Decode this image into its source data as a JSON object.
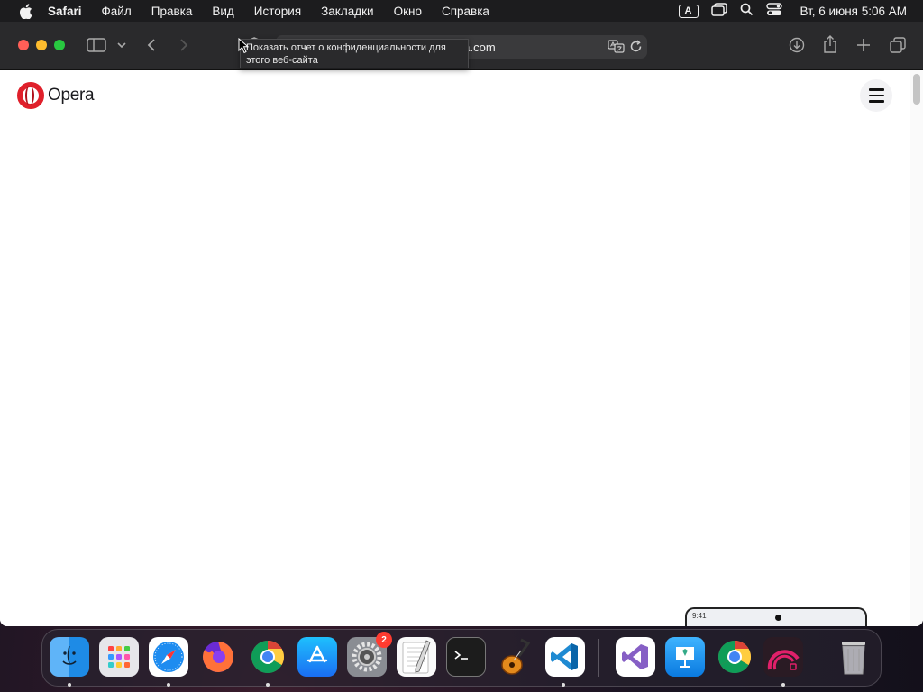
{
  "menubar": {
    "app_name": "Safari",
    "items": [
      "Файл",
      "Правка",
      "Вид",
      "История",
      "Закладки",
      "Окно",
      "Справка"
    ],
    "input_source": "A",
    "datetime": "Вт, 6 июня  5:06 AM"
  },
  "browser": {
    "url": "opera.com",
    "tooltip": "Показать отчет о конфиденциальности для этого веб-сайта"
  },
  "page": {
    "brand": "Opera",
    "phone_time": "9:41"
  },
  "dock": {
    "apps": [
      {
        "name": "Finder",
        "running": true
      },
      {
        "name": "Launchpad",
        "running": false
      },
      {
        "name": "Safari",
        "running": true
      },
      {
        "name": "Firefox",
        "running": false
      },
      {
        "name": "Google Chrome",
        "running": true
      },
      {
        "name": "App Store",
        "running": false
      },
      {
        "name": "System Settings",
        "running": false,
        "badge": "2"
      },
      {
        "name": "TextEdit",
        "running": false
      },
      {
        "name": "Terminal",
        "running": false
      },
      {
        "name": "GarageBand",
        "running": false
      },
      {
        "name": "Visual Studio Code",
        "running": true
      },
      {
        "name": "Visual Studio",
        "running": false
      },
      {
        "name": "Keynote",
        "running": false
      },
      {
        "name": "Google Chrome",
        "running": false
      },
      {
        "name": "Speedometer",
        "running": true
      },
      {
        "name": "Trash",
        "running": false
      }
    ]
  },
  "colors": {
    "menubar_bg": "#1c1c1e",
    "toolbar_bg": "#2a2a2c",
    "opera_red": "#e0202b",
    "badge_red": "#ff3b30"
  }
}
